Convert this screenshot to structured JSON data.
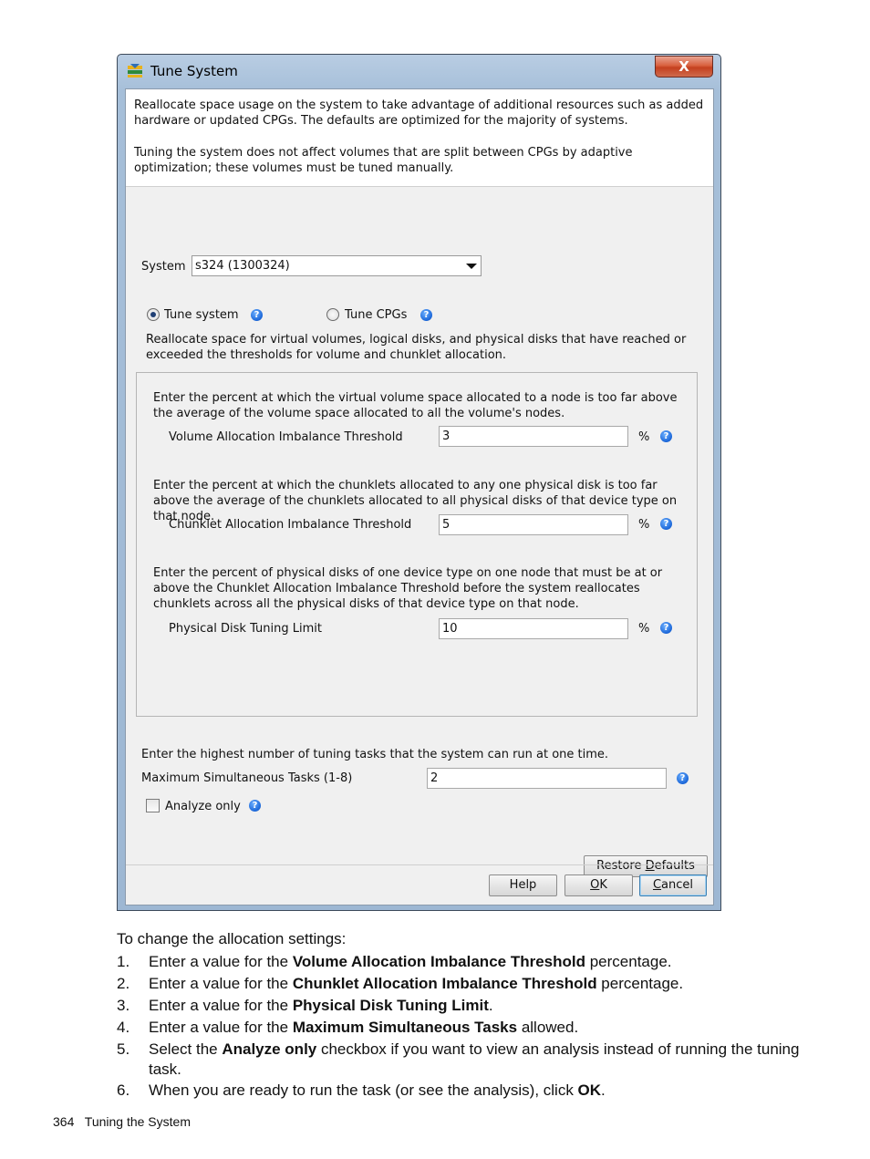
{
  "dialog": {
    "title": "Tune System",
    "close_label": "X",
    "intro_1": "Reallocate space usage on the system to take advantage of additional resources such as added hardware or updated CPGs. The defaults are optimized for the majority of systems.",
    "intro_2": "Tuning the system does not affect volumes that are split between CPGs by adaptive optimization; these volumes must be tuned manually.",
    "system_label": "System",
    "system_value": "s324 (1300324)",
    "radio_tune_system": "Tune system",
    "radio_tune_cpgs": "Tune CPGs",
    "radio_selected": "Tune system",
    "reallocate_text": "Reallocate space for virtual volumes, logical disks, and physical disks that have reached or exceeded the thresholds for volume and chunklet allocation.",
    "vol_desc": "Enter the percent at which the virtual volume space allocated to a node is too far above the average of the volume space allocated to all the volume's nodes.",
    "vol_label": "Volume Allocation Imbalance Threshold",
    "vol_value": "3",
    "chunk_desc": "Enter the percent at which the chunklets allocated to any one physical disk is too far above the average of the chunklets allocated to all physical disks of that device type on that node.",
    "chunk_label": "Chunklet Allocation Imbalance Threshold",
    "chunk_value": "5",
    "pd_desc": "Enter the percent of physical disks of one device type on one node that must be at or above the Chunklet Allocation Imbalance Threshold before the system reallocates chunklets across all the physical disks of that device type on that node.",
    "pd_label": "Physical Disk Tuning Limit",
    "pd_value": "10",
    "percent": "%",
    "tasks_desc": "Enter the highest number of tuning tasks that the system can run at one time.",
    "tasks_label": "Maximum Simultaneous Tasks (1-8)",
    "tasks_value": "2",
    "analyze_label": "Analyze only",
    "analyze_checked": false,
    "restore_pre": "Restore ",
    "restore_u": "D",
    "restore_post": "efaults",
    "help_label": "Help",
    "ok_u": "O",
    "ok_post": "K",
    "cancel_u": "C",
    "cancel_post": "ancel",
    "help_glyph": "?"
  },
  "doc": {
    "lead": "To change the allocation settings:",
    "steps": [
      {
        "num": "1.",
        "pre": "Enter a value for the ",
        "bold": "Volume Allocation Imbalance Threshold",
        "post": " percentage."
      },
      {
        "num": "2.",
        "pre": "Enter a value for the ",
        "bold": "Chunklet Allocation Imbalance Threshold",
        "post": " percentage."
      },
      {
        "num": "3.",
        "pre": "Enter a value for the ",
        "bold": "Physical Disk Tuning Limit",
        "post": "."
      },
      {
        "num": "4.",
        "pre": "Enter a value for the ",
        "bold": "Maximum Simultaneous Tasks",
        "post": " allowed."
      },
      {
        "num": "5.",
        "pre": "Select the ",
        "bold": "Analyze only",
        "post": " checkbox if you want to view an analysis instead of running the tuning task."
      },
      {
        "num": "6.",
        "pre": "When you are ready to run the task (or see the analysis), click ",
        "bold": "OK",
        "post": "."
      }
    ],
    "page_number": "364",
    "section": "Tuning the System"
  },
  "colors": {
    "window_frame": "#a6bfd9",
    "close_button": "#c4401f",
    "help_icon": "#1a66d8"
  }
}
